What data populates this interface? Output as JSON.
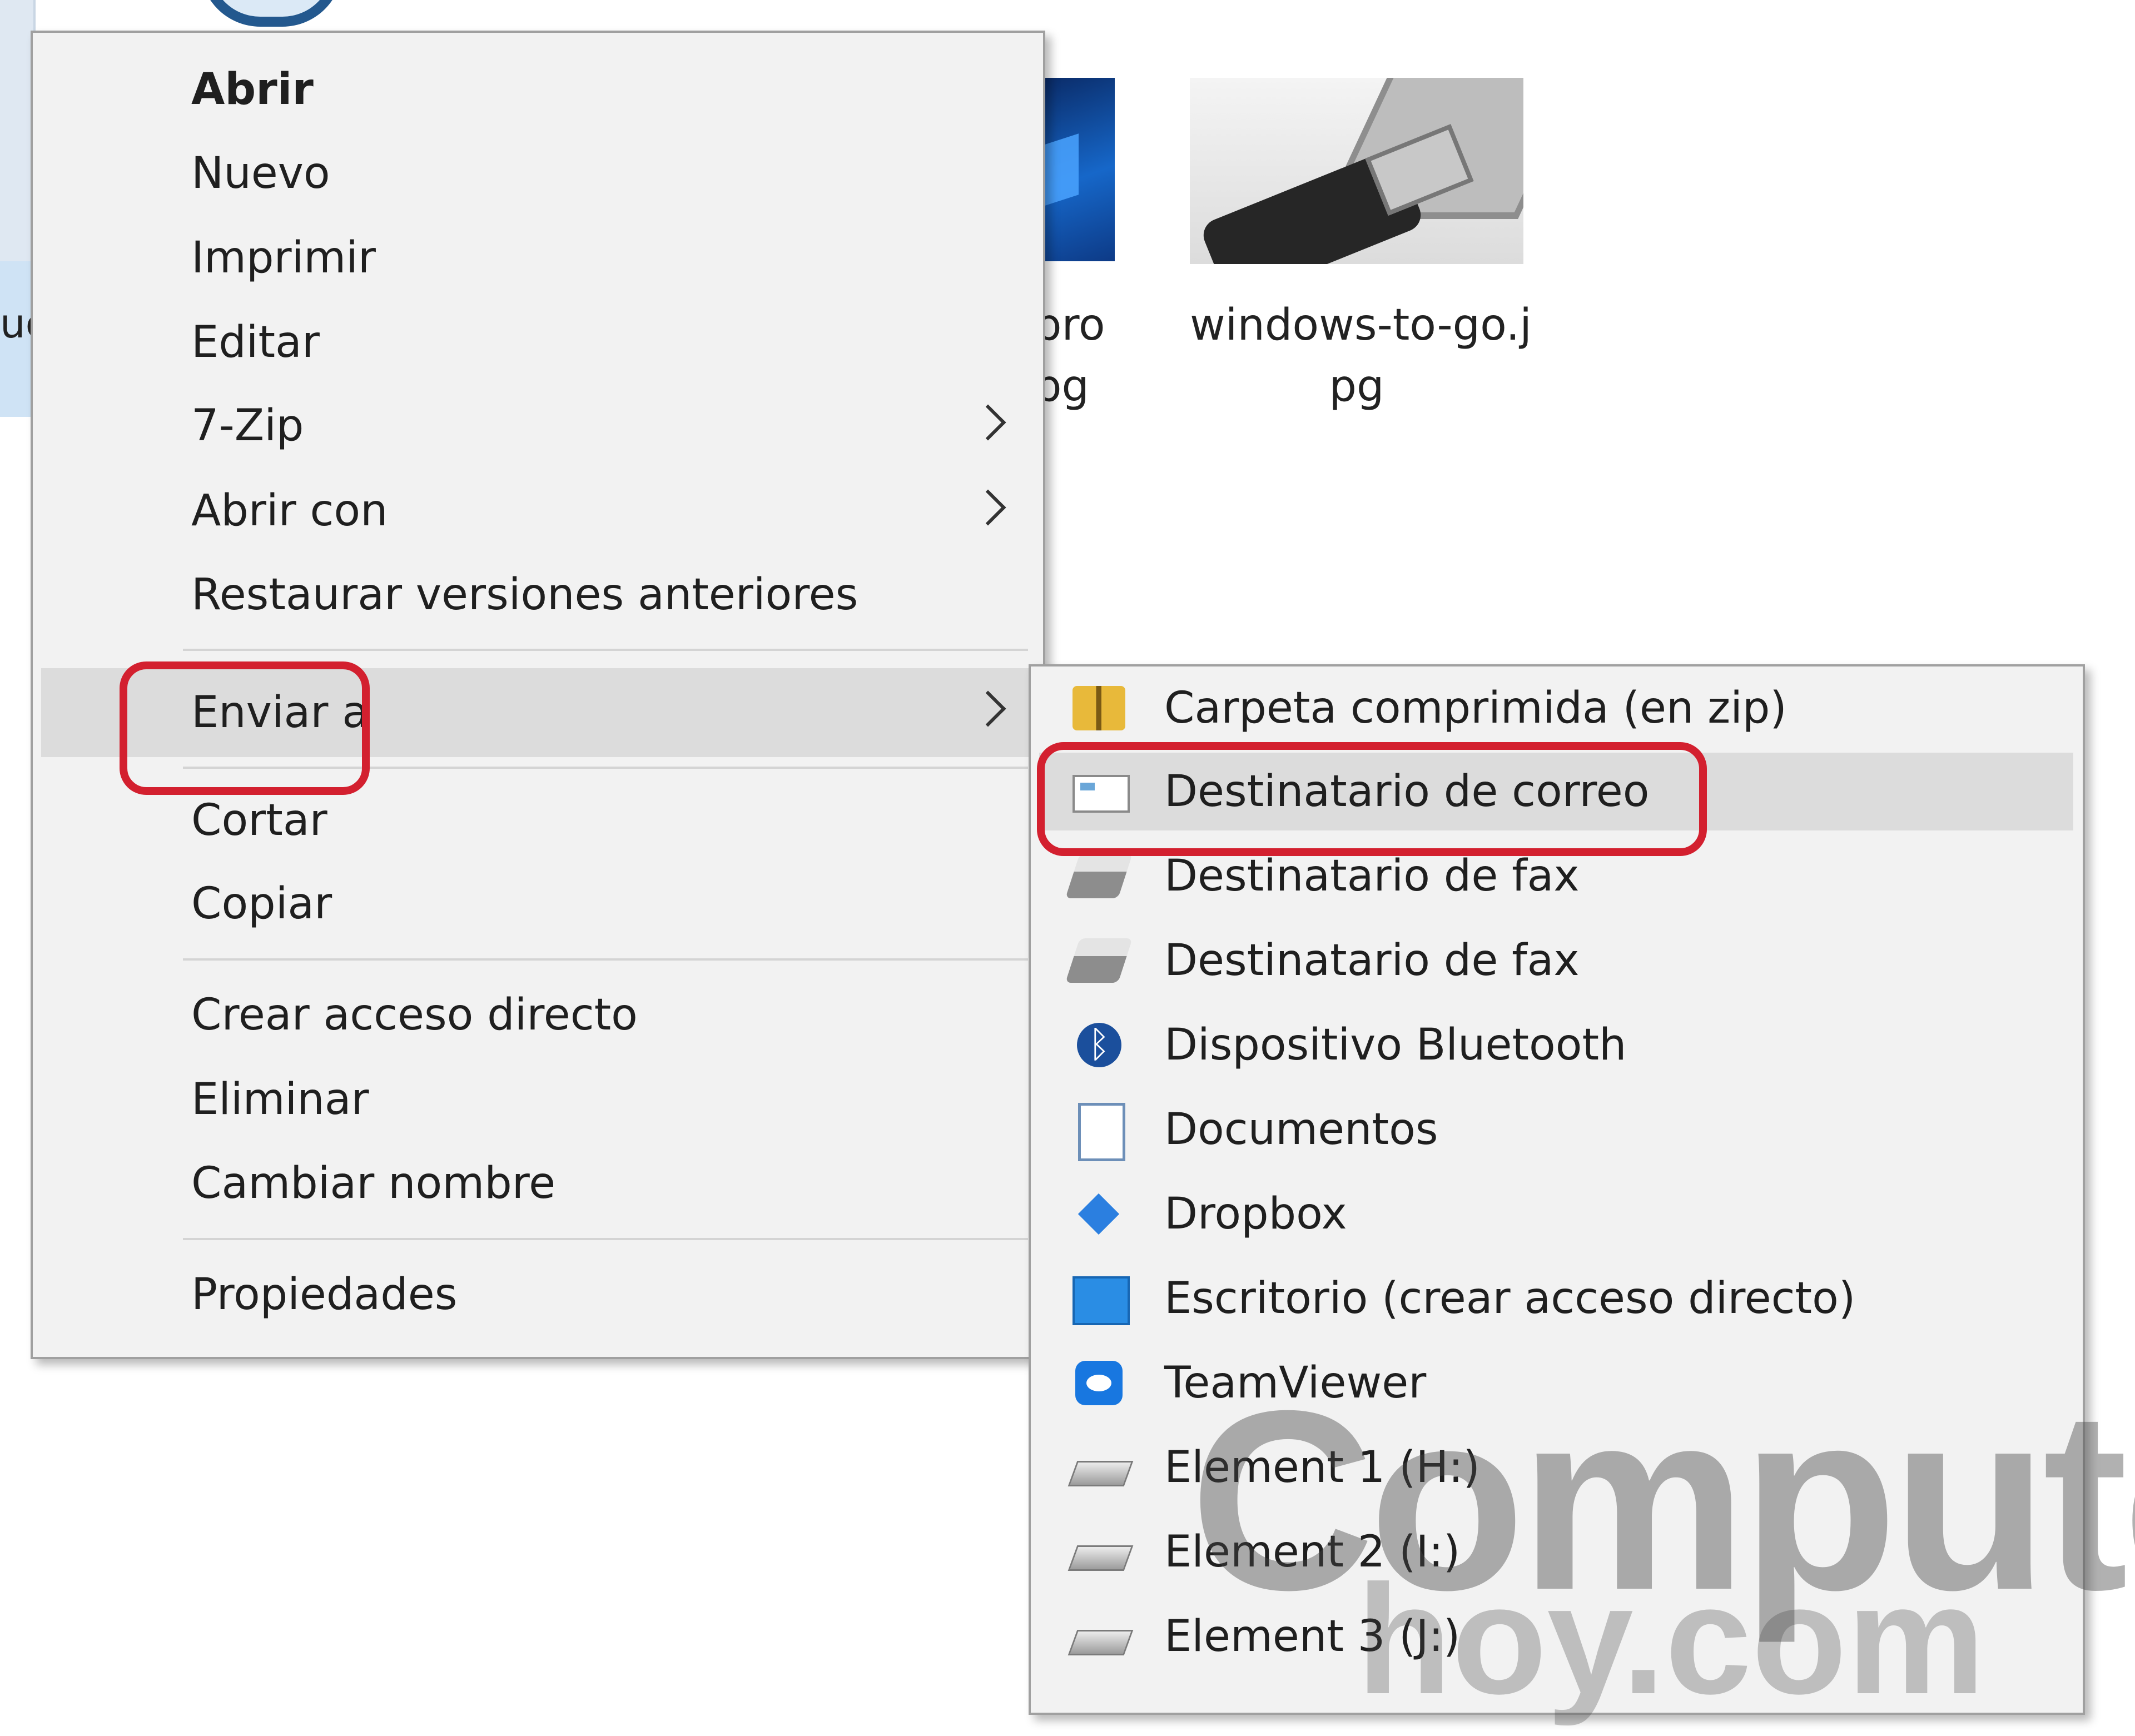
{
  "background": {
    "partial_file_label": "uc",
    "file_label_middle": "pro\npg",
    "file_label_usb": "windows-to-go.j\npg"
  },
  "context_menu": {
    "items": [
      {
        "label": "Abrir",
        "bold": true
      },
      {
        "label": "Nuevo"
      },
      {
        "label": "Imprimir"
      },
      {
        "label": "Editar"
      },
      {
        "label": "7-Zip",
        "submenu": true
      },
      {
        "label": "Abrir con",
        "submenu": true
      },
      {
        "label": "Restaurar versiones anteriores"
      },
      {
        "label": "Enviar a",
        "submenu": true,
        "highlighted": true
      },
      {
        "label": "Cortar"
      },
      {
        "label": "Copiar"
      },
      {
        "label": "Crear acceso directo"
      },
      {
        "label": "Eliminar"
      },
      {
        "label": "Cambiar nombre"
      },
      {
        "label": "Propiedades"
      }
    ]
  },
  "send_to_submenu": {
    "items": [
      {
        "label": "Carpeta comprimida (en zip)",
        "icon": "zip-folder-icon"
      },
      {
        "label": "Destinatario de correo",
        "icon": "mail-icon",
        "highlighted": true
      },
      {
        "label": "Destinatario de fax",
        "icon": "fax-icon"
      },
      {
        "label": "Destinatario de fax",
        "icon": "fax-icon"
      },
      {
        "label": "Dispositivo Bluetooth",
        "icon": "bluetooth-icon"
      },
      {
        "label": "Documentos",
        "icon": "documents-icon"
      },
      {
        "label": "Dropbox",
        "icon": "dropbox-icon"
      },
      {
        "label": "Escritorio (crear acceso directo)",
        "icon": "desktop-icon"
      },
      {
        "label": "TeamViewer",
        "icon": "teamviewer-icon"
      },
      {
        "label": "Element 1 (H:)",
        "icon": "drive-icon"
      },
      {
        "label": "Element 2 (I:)",
        "icon": "drive-icon"
      },
      {
        "label": "Element 3 (J:)",
        "icon": "drive-icon"
      }
    ]
  },
  "watermark": {
    "main": "Computer",
    "sub": "hoy.com"
  },
  "colors": {
    "annotation_ring": "#d3202f",
    "menu_background": "#f2f2f2",
    "highlight": "#dcdcdc"
  }
}
